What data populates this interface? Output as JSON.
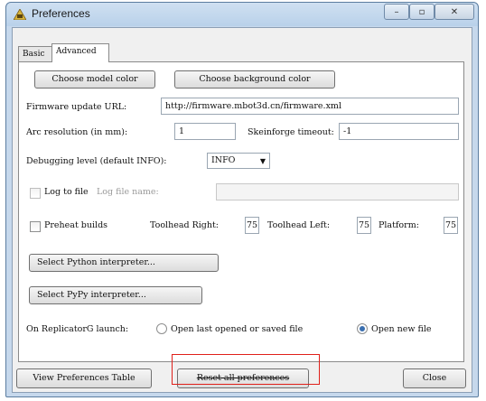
{
  "window": {
    "title": "Preferences",
    "minimize_icon": "minimize-icon",
    "maximize_icon": "maximize-icon",
    "close_icon": "close-icon",
    "controls": {
      "minimize": "–",
      "maximize": "▫",
      "close": "✕"
    }
  },
  "tabs": [
    {
      "label": "Basic",
      "active": false
    },
    {
      "label": "Advanced",
      "active": true
    }
  ],
  "advanced": {
    "choose_model_color": "Choose model color",
    "choose_background_color": "Choose background color",
    "firmware_label": "Firmware update URL:",
    "firmware_value": "http://firmware.mbot3d.cn/firmware.xml",
    "arc_label": "Arc resolution (in mm):",
    "arc_value": "1",
    "skein_label": "Skeinforge timeout:",
    "skein_value": "-1",
    "debug_label": "Debugging level (default INFO):",
    "debug_value": "INFO",
    "debug_arrow": "▼",
    "log_label": "Log to file",
    "log_name_label": "Log file name:",
    "log_name_value": "",
    "preheat_label": "Preheat builds",
    "toolhead_right_label": "Toolhead Right:",
    "toolhead_right_value": "75",
    "toolhead_left_label": "Toolhead Left:",
    "toolhead_left_value": "75",
    "platform_label": "Platform:",
    "platform_value": "75",
    "python_button": "Select Python interpreter...",
    "pypy_button": "Select PyPy interpreter...",
    "launch_label": "On ReplicatorG launch:",
    "radio_open_last": "Open last opened or saved file",
    "radio_open_new": "Open new file",
    "selected_launch": "Open new file"
  },
  "footer": {
    "view_table": "View Preferences Table",
    "reset_all": "Reset all preferences",
    "close": "Close"
  },
  "colors": {
    "highlight": "#e0201a",
    "radio_selected": "#3a6fb0"
  }
}
